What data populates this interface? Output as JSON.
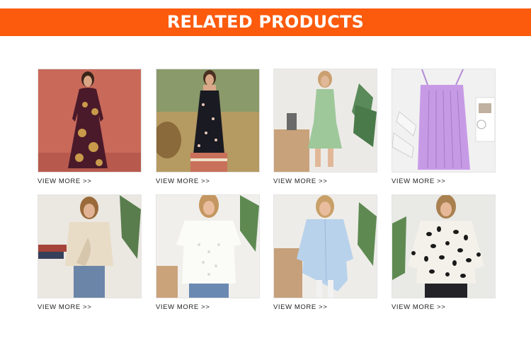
{
  "header": {
    "title": "RELATED PRODUCTS",
    "accent_color": "#fc5a0d"
  },
  "products": [
    {
      "image_alt": "burgundy paisley print long-sleeve maxi dress",
      "link_label": "VIEW MORE >>"
    },
    {
      "image_alt": "black floral print sleeveless maxi dress",
      "link_label": "VIEW MORE >>"
    },
    {
      "image_alt": "sage green sleeveless tiered mini dress",
      "link_label": "VIEW MORE >>"
    },
    {
      "image_alt": "lilac ribbed bodycon slip dress",
      "link_label": "VIEW MORE >>"
    },
    {
      "image_alt": "beige twist-front short-sleeve blouse",
      "link_label": "VIEW MORE >>"
    },
    {
      "image_alt": "white eyelet short-sleeve top",
      "link_label": "VIEW MORE >>"
    },
    {
      "image_alt": "light blue high-low button-down shirt",
      "link_label": "VIEW MORE >>"
    },
    {
      "image_alt": "leopard print long-sleeve blouse",
      "link_label": "VIEW MORE >>"
    }
  ]
}
